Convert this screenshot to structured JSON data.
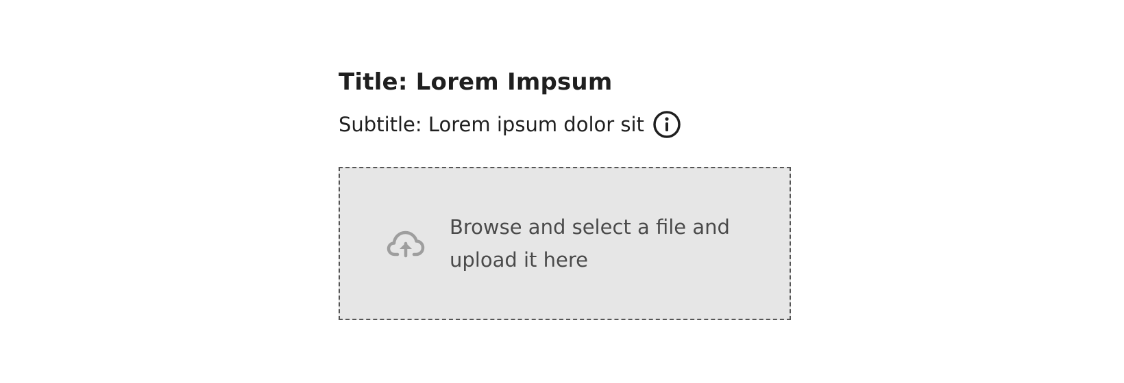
{
  "header": {
    "title": "Title: Lorem Impsum",
    "subtitle": "Subtitle: Lorem ipsum dolor sit"
  },
  "icons": {
    "info": "info-icon",
    "upload": "cloud-upload-icon"
  },
  "dropzone": {
    "text": "Browse and select a file and upload it here"
  },
  "colors": {
    "text": "#1f1f1f",
    "muted_text": "#4a4a4a",
    "dropzone_bg": "#e6e6e6",
    "dropzone_border": "#555555",
    "upload_icon": "#9e9e9e"
  }
}
